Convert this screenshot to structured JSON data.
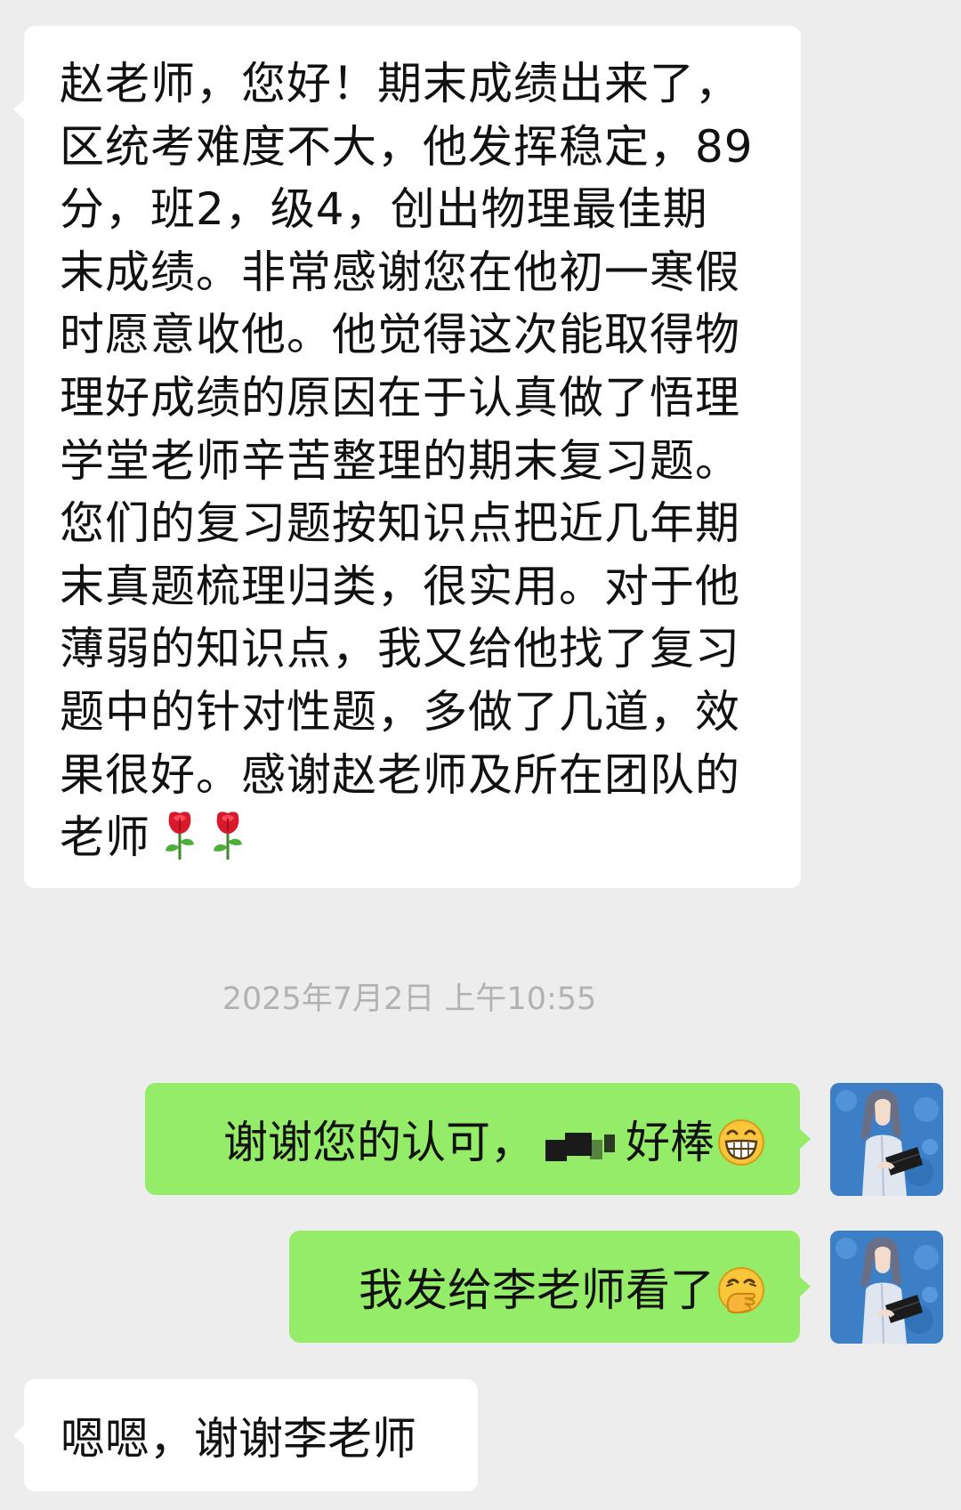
{
  "messages": [
    {
      "sender": "incoming",
      "text": "赵老师，您好！期末成绩出来了，\n区统考难度不大，他发挥稳定，89\n分，班2，级4，创出物理最佳期\n末成绩。非常感谢您在他初一寒假\n时愿意收他。他觉得这次能取得物\n理好成绩的原因在于认真做了悟理\n学堂老师辛苦整理的期末复习题。\n您们的复习题按知识点把近几年期\n末真题梳理归类，很实用。对于他\n薄弱的知识点，我又给他找了复习\n题中的针对性题，多做了几道，效\n果很好。感谢赵老师及所在团队的\n老师",
      "emojis": [
        "rose-icon",
        "rose-icon"
      ]
    },
    {
      "sender": "outgoing",
      "text": "谢谢您的认可，",
      "text_after_redaction": "好棒",
      "emoji": "grin-icon"
    },
    {
      "sender": "outgoing",
      "text": "我发给李老师看了",
      "emoji": "hand-over-mouth-icon"
    },
    {
      "sender": "incoming",
      "text": "嗯嗯，谢谢李老师"
    }
  ],
  "timestamp": "2025年7月2日 上午10:55",
  "colors": {
    "background": "#ededed",
    "incoming_bubble": "#ffffff",
    "outgoing_bubble": "#95ec69",
    "timestamp_text": "#b2b2b2"
  }
}
